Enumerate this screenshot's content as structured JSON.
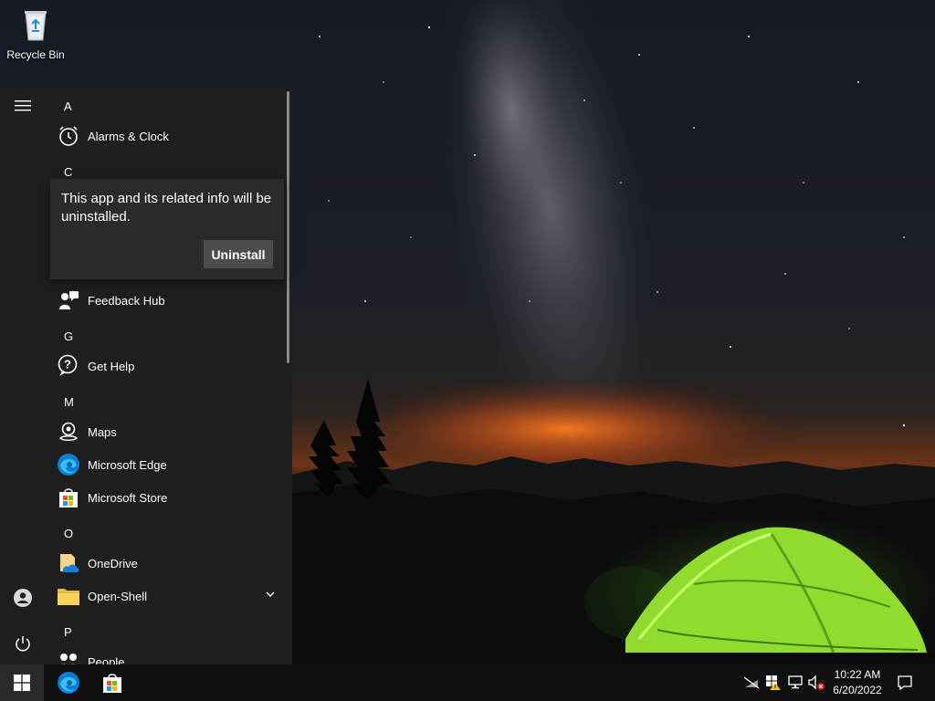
{
  "desktop": {
    "icons": [
      {
        "label": "Recycle Bin",
        "icon": "recycle-bin-icon"
      }
    ]
  },
  "start_menu": {
    "rail": {
      "menu_icon": "hamburger-icon",
      "user_icon": "user-icon",
      "power_icon": "power-icon"
    },
    "groups": [
      {
        "header": "A",
        "apps": [
          {
            "name": "Alarms & Clock",
            "icon": "alarm-clock-icon"
          }
        ]
      },
      {
        "header": "C",
        "apps": []
      },
      {
        "header": "",
        "apps": [
          {
            "name": "Feedback Hub",
            "icon": "feedback-hub-icon"
          }
        ]
      },
      {
        "header": "G",
        "apps": [
          {
            "name": "Get Help",
            "icon": "get-help-icon"
          }
        ]
      },
      {
        "header": "M",
        "apps": [
          {
            "name": "Maps",
            "icon": "maps-icon"
          },
          {
            "name": "Microsoft Edge",
            "icon": "edge-icon"
          },
          {
            "name": "Microsoft Store",
            "icon": "store-icon"
          }
        ]
      },
      {
        "header": "O",
        "apps": [
          {
            "name": "OneDrive",
            "icon": "onedrive-icon"
          },
          {
            "name": "Open-Shell",
            "icon": "folder-icon",
            "expandable": true
          }
        ]
      },
      {
        "header": "P",
        "apps": [
          {
            "name": "People",
            "icon": "people-icon"
          }
        ]
      }
    ]
  },
  "flyout": {
    "message": "This app and its related info will be uninstalled.",
    "button_label": "Uninstall"
  },
  "taskbar": {
    "pinned": [
      "edge-icon",
      "store-icon"
    ],
    "tray": [
      "network-off-icon",
      "security-warning-icon",
      "network-icon",
      "volume-muted-icon"
    ],
    "time": "10:22 AM",
    "date": "6/20/2022",
    "notification_icon": "action-center-icon"
  }
}
